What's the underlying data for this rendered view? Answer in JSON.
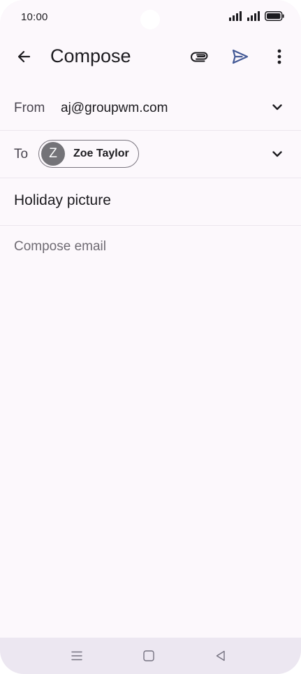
{
  "status_bar": {
    "time": "10:00",
    "icons": [
      "signal-icon",
      "signal-icon",
      "battery-icon"
    ]
  },
  "app_bar": {
    "title": "Compose",
    "back_icon": "arrow-left-icon",
    "attach_icon": "paperclip-icon",
    "send_icon": "send-icon",
    "more_icon": "more-vert-icon"
  },
  "from": {
    "label": "From",
    "value": "aj@groupwm.com",
    "expand_icon": "chevron-down-icon"
  },
  "to": {
    "label": "To",
    "recipients": [
      {
        "initial": "Z",
        "name": "Zoe Taylor"
      }
    ],
    "expand_icon": "chevron-down-icon"
  },
  "subject": {
    "value": "Holiday picture"
  },
  "body": {
    "placeholder": "Compose email",
    "value": ""
  },
  "nav_bar": {
    "icons": [
      "menu-icon",
      "home-square-icon",
      "back-triangle-icon"
    ]
  },
  "colors": {
    "background": "#fcf8fc",
    "send_accent": "#445a96",
    "divider": "#ece6ed",
    "nav_bar": "#ece7f1",
    "avatar": "#747378"
  }
}
